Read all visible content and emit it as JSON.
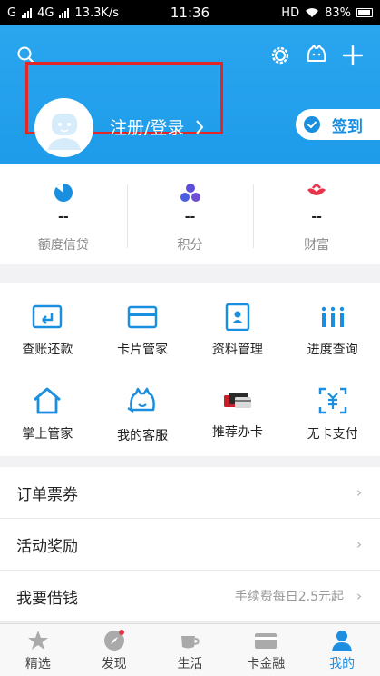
{
  "status_bar": {
    "carrier_left": "G",
    "network": "4G",
    "speed": "13.3K/s",
    "time": "11:36",
    "hd": "HD",
    "battery": "83%"
  },
  "header": {
    "login_label": "注册/登录",
    "checkin_label": "签到",
    "brand_color": "#1e9be9"
  },
  "stats": [
    {
      "icon": "pie-chart-icon",
      "value": "--",
      "label": "额度信贷"
    },
    {
      "icon": "points-icon",
      "value": "--",
      "label": "积分"
    },
    {
      "icon": "wealth-icon",
      "value": "--",
      "label": "财富"
    }
  ],
  "services": [
    {
      "icon": "bill-repay-icon",
      "label": "查账还款"
    },
    {
      "icon": "card-manager-icon",
      "label": "卡片管家"
    },
    {
      "icon": "profile-manage-icon",
      "label": "资料管理"
    },
    {
      "icon": "progress-query-icon",
      "label": "进度查询"
    },
    {
      "icon": "home-icon",
      "label": "掌上管家"
    },
    {
      "icon": "customer-service-icon",
      "label": "我的客服"
    },
    {
      "icon": "recommend-card-icon",
      "label": "推荐办卡"
    },
    {
      "icon": "cardless-pay-icon",
      "label": "无卡支付"
    }
  ],
  "list": [
    {
      "label": "订单票券",
      "hint": ""
    },
    {
      "label": "活动奖励",
      "hint": ""
    },
    {
      "label": "我要借钱",
      "hint": "手续费每日2.5元起"
    }
  ],
  "tabs": [
    {
      "icon": "star-icon",
      "label": "精选",
      "active": false
    },
    {
      "icon": "compass-icon",
      "label": "发现",
      "active": false
    },
    {
      "icon": "cup-icon",
      "label": "生活",
      "active": false
    },
    {
      "icon": "card-icon",
      "label": "卡金融",
      "active": false
    },
    {
      "icon": "user-icon",
      "label": "我的",
      "active": true
    }
  ]
}
